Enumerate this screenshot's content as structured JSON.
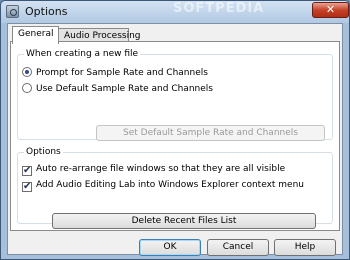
{
  "window": {
    "title": "Options",
    "watermark": "SOFTPEDIA",
    "close_glyph": "✕"
  },
  "tabs": [
    {
      "label": "General",
      "active": true
    },
    {
      "label": "Audio Processing",
      "active": false
    }
  ],
  "group_new_file": {
    "legend": "When creating a new file",
    "radio_prompt": {
      "label": "Prompt for Sample Rate and Channels",
      "checked": true
    },
    "radio_default": {
      "label": "Use Default Sample Rate and Channels",
      "checked": false
    },
    "set_default_button": "Set Default Sample Rate and Channels"
  },
  "group_options": {
    "legend": "Options",
    "check_rearrange": {
      "label": "Auto re-arrange file windows so that they are all visible",
      "checked": true
    },
    "check_context_menu": {
      "label": "Add Audio Editing Lab into Windows Explorer context menu",
      "checked": true
    },
    "delete_button": "Delete Recent Files List"
  },
  "footer": {
    "ok": "OK",
    "cancel": "Cancel",
    "help": "Help"
  },
  "icons": {
    "app": "app-icon",
    "close": "close-icon",
    "check_glyph": "✔"
  }
}
